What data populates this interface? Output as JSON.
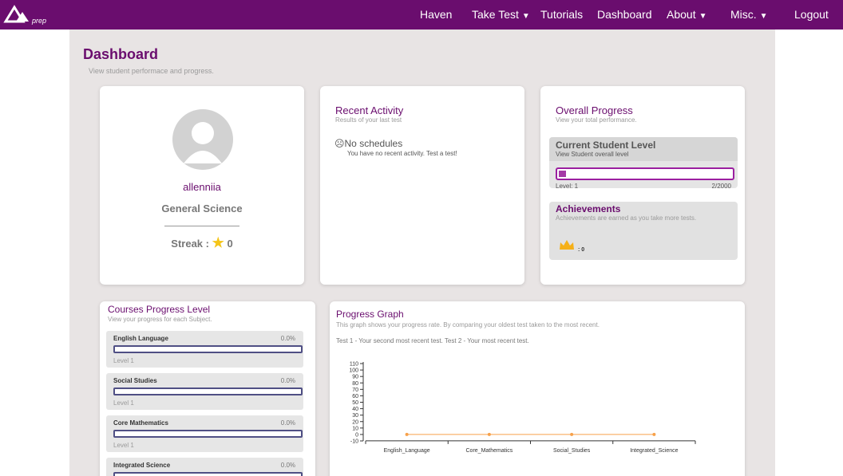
{
  "nav": {
    "logo_text": "prep",
    "items": [
      "Haven",
      "Take Test",
      "Tutorials",
      "Dashboard",
      "About",
      "Misc.",
      "Logout"
    ]
  },
  "page": {
    "title": "Dashboard",
    "subtitle": "View student performace and progress."
  },
  "profile": {
    "username": "allenniia",
    "subject": "General Science",
    "streak_label": "Streak :",
    "streak_value": "0"
  },
  "recent": {
    "title": "Recent Activity",
    "subtitle": "Results of your last test",
    "empty_title": "No schedules",
    "empty_text": "You have no recent activity. Test a test!"
  },
  "overall": {
    "title": "Overall Progress",
    "subtitle": "View your total performance.",
    "level_title": "Current Student Level",
    "level_sub": "View Student overall level",
    "level_label": "Level: 1",
    "level_value": "2/2000",
    "level_fraction": 0.001,
    "ach_title": "Achievements",
    "ach_sub": "Achievements are earned as you take more tests.",
    "ach_count": ": 0"
  },
  "courses": {
    "title": "Courses Progress Level",
    "subtitle": "View your progress for each Subject.",
    "items": [
      {
        "name": "English Language",
        "pct": "0.0%",
        "level": "Level 1"
      },
      {
        "name": "Social Studies",
        "pct": "0.0%",
        "level": "Level 1"
      },
      {
        "name": "Core Mathematics",
        "pct": "0.0%",
        "level": "Level 1"
      },
      {
        "name": "Integrated Science",
        "pct": "0.0%",
        "level": ""
      }
    ]
  },
  "graph": {
    "title": "Progress Graph",
    "subtitle": "This graph shows your progress rate. By comparing your oldest test taken to the most recent.",
    "note": "Test 1 - Your second most recent test. Test 2 - Your most recent test."
  },
  "colors": {
    "nav": "#6a0d6e",
    "accent": "#6a0d6e",
    "page_bg": "#e8e4e4",
    "series": "#f7a14a"
  },
  "chart_data": {
    "type": "line",
    "categories": [
      "English_Language",
      "Core_Mathematics",
      "Social_Studies",
      "Integrated_Science"
    ],
    "series": [
      {
        "values": [
          0,
          0,
          0,
          0
        ]
      }
    ],
    "yticks": [
      110,
      100,
      90,
      80,
      70,
      60,
      50,
      40,
      30,
      20,
      10,
      0,
      -10
    ],
    "ylim": [
      -10,
      110
    ],
    "grid": false
  }
}
